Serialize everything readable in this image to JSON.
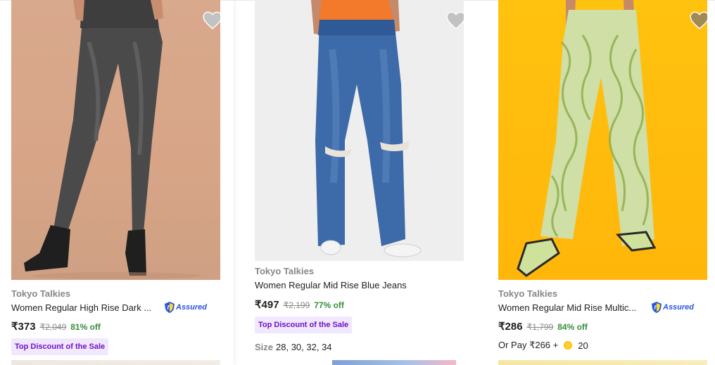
{
  "products": [
    {
      "brand": "Tokyo Talkies",
      "title": "Women Regular High Rise Dark ...",
      "assured": "Assured",
      "price": "₹373",
      "mrp": "₹2,049",
      "discount": "81% off",
      "tag": "Top Discount of the Sale"
    },
    {
      "brand": "Tokyo Talkies",
      "title": "Women Regular Mid Rise Blue Jeans",
      "price": "₹497",
      "mrp": "₹2,199",
      "discount": "77% off",
      "tag": "Top Discount of the Sale",
      "size_label": "Size",
      "sizes": "28, 30, 32, 34"
    },
    {
      "brand": "Tokyo Talkies",
      "title": "Women Regular Mid Rise Multic...",
      "assured": "Assured",
      "price": "₹286",
      "mrp": "₹1,799",
      "discount": "84% off",
      "or_pay": "Or Pay ₹266 +",
      "coins": "20"
    }
  ],
  "colors": {
    "accent": "#2874f0",
    "discount_green": "#388e3c",
    "tag_purple": "#6d12c2",
    "tag_bg": "#f1e8ff",
    "assured_blue": "#2a55e5"
  },
  "icons": [
    "heart-icon",
    "assured-shield-icon",
    "supercoin-icon"
  ]
}
